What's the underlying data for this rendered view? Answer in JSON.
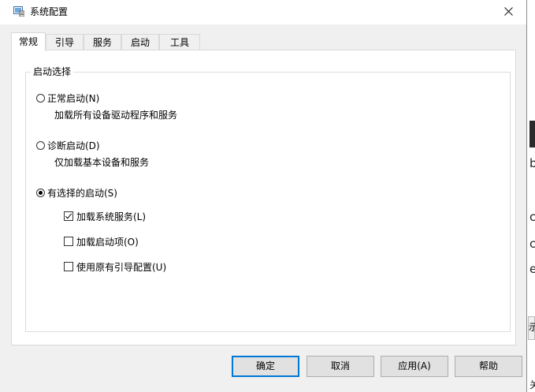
{
  "window": {
    "title": "系统配置",
    "close_glyph": "✕"
  },
  "tabs": [
    {
      "label": "常规",
      "active": true
    },
    {
      "label": "引导",
      "active": false
    },
    {
      "label": "服务",
      "active": false
    },
    {
      "label": "启动",
      "active": false
    },
    {
      "label": "工具",
      "active": false
    }
  ],
  "startup_selection": {
    "legend": "启动选择",
    "options": [
      {
        "label": "正常启动(N)",
        "description": "加载所有设备驱动程序和服务",
        "selected": false
      },
      {
        "label": "诊断启动(D)",
        "description": "仅加载基本设备和服务",
        "selected": false
      },
      {
        "label": "有选择的启动(S)",
        "selected": true
      }
    ],
    "selective_items": [
      {
        "label": "加载系统服务(L)",
        "checked": true
      },
      {
        "label": "加载启动项(O)",
        "checked": false
      },
      {
        "label": "使用原有引导配置(U)",
        "checked": false
      }
    ]
  },
  "buttons": {
    "ok": "确定",
    "cancel": "取消",
    "apply": "应用(A)",
    "help": "帮助"
  },
  "background_text": {
    "letters": [
      "b",
      "c",
      "c",
      "e"
    ],
    "box_char": "示",
    "corner_char": "关"
  },
  "colors": {
    "dialog_bg": "#f0f0f0",
    "panel_bg": "#ffffff",
    "default_button_border": "#0078d7",
    "button_bg": "#e1e1e1"
  }
}
